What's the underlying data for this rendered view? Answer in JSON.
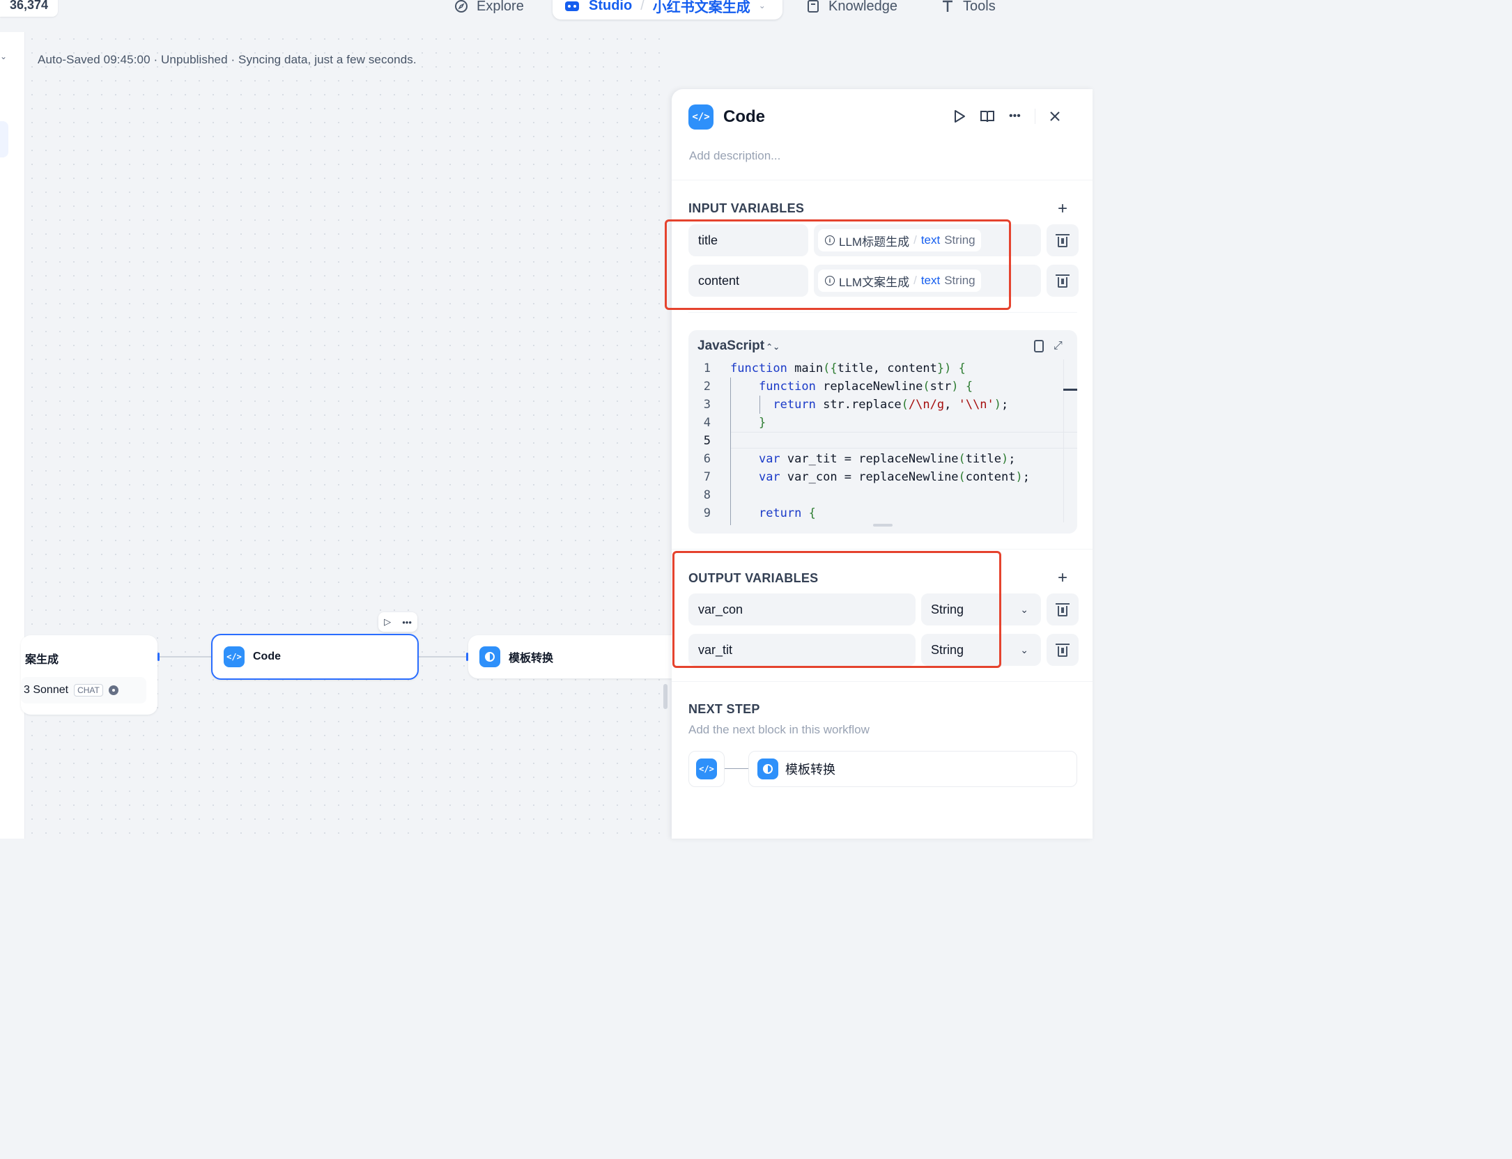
{
  "topnav": {
    "counter": "36,374",
    "explore": "Explore",
    "studio": "Studio",
    "app_name": "小红书文案生成",
    "knowledge": "Knowledge",
    "tools": "Tools"
  },
  "status_bar": "Auto-Saved 09:45:00 · Unpublished · Syncing data, just a few seconds.",
  "canvas": {
    "llm_node": {
      "title": "案生成",
      "model": "3 Sonnet",
      "badge": "CHAT"
    },
    "code_node": {
      "title": "Code"
    },
    "template_node": {
      "title": "模板转换"
    }
  },
  "panel": {
    "title": "Code",
    "description_placeholder": "Add description...",
    "input_section": "INPUT VARIABLES",
    "inputs": [
      {
        "name": "title",
        "source_node": "LLM标题生成",
        "var": "text",
        "type": "String"
      },
      {
        "name": "content",
        "source_node": "LLM文案生成",
        "var": "text",
        "type": "String"
      }
    ],
    "language": "JavaScript",
    "code_lines": [
      {
        "n": "1",
        "text": "function main({title, content}) {"
      },
      {
        "n": "2",
        "text": "    function replaceNewline(str) {"
      },
      {
        "n": "3",
        "text": "      return str.replace(/\\n/g, '\\\\n');"
      },
      {
        "n": "4",
        "text": "    }"
      },
      {
        "n": "5",
        "text": ""
      },
      {
        "n": "6",
        "text": "    var var_tit = replaceNewline(title);"
      },
      {
        "n": "7",
        "text": "    var var_con = replaceNewline(content);"
      },
      {
        "n": "8",
        "text": ""
      },
      {
        "n": "9",
        "text": "    return {"
      }
    ],
    "output_section": "OUTPUT VARIABLES",
    "outputs": [
      {
        "name": "var_con",
        "type": "String"
      },
      {
        "name": "var_tit",
        "type": "String"
      }
    ],
    "next_step_title": "NEXT STEP",
    "next_step_desc": "Add the next block in this workflow",
    "next_step_target": "模板转换"
  },
  "colors": {
    "accent": "#155eef",
    "annotation_red": "#e5432e",
    "node_selected": "#296dff"
  }
}
